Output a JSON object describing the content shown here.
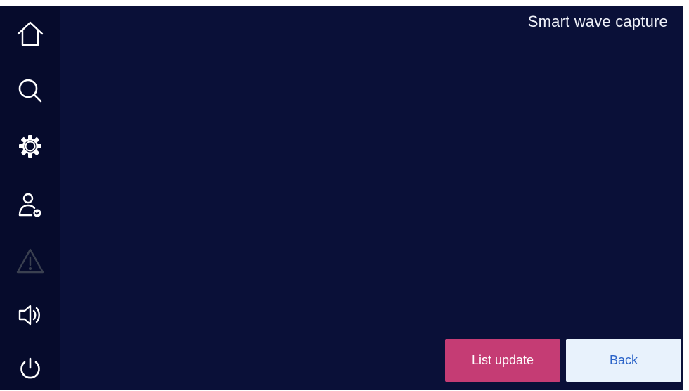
{
  "header": {
    "title": "Smart wave capture"
  },
  "sidebar": {
    "items": [
      {
        "icon": "home-icon",
        "enabled": true
      },
      {
        "icon": "search-icon",
        "enabled": true
      },
      {
        "icon": "gear-icon",
        "enabled": true
      },
      {
        "icon": "user-check-icon",
        "enabled": true
      },
      {
        "icon": "warning-icon",
        "enabled": false
      },
      {
        "icon": "speaker-icon",
        "enabled": true
      },
      {
        "icon": "power-icon",
        "enabled": true
      }
    ]
  },
  "actions": {
    "list_update_label": "List update",
    "back_label": "Back"
  },
  "colors": {
    "background": "#0a1038",
    "sidebar": "#060b2c",
    "list_update_button": "#c53c74",
    "back_button": "#e8f2fc",
    "back_text": "#2a63c8"
  }
}
